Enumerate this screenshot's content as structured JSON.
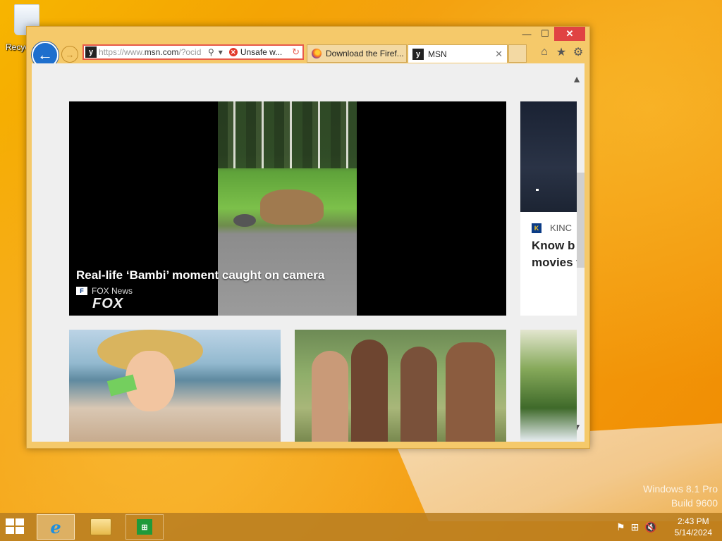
{
  "desktop": {
    "recycle_bin_label": "Recycle Bin",
    "watermark_line1": "Windows 8.1 Pro",
    "watermark_line2": "Build 9600"
  },
  "window": {
    "minimize": "—",
    "maximize": "☐",
    "close": "✕"
  },
  "navbar": {
    "back_symbol": "←",
    "forward_symbol": "→",
    "url_prefix": "https://www.",
    "url_host": "msn.com",
    "url_rest": "/?ocid",
    "search_symbol": "⚲",
    "dropdown_symbol": "▾",
    "unsafe_label": "Unsafe w...",
    "refresh_symbol": "↻"
  },
  "tabs": [
    {
      "label": "Download the Firef...",
      "icon": "firefox-icon"
    },
    {
      "label": "MSN",
      "icon": "msn-icon",
      "close": "✕"
    }
  ],
  "toolbar_icons": [
    "home-icon",
    "favorites-star-icon",
    "settings-gear-icon"
  ],
  "toolbar_symbols": {
    "home": "⌂",
    "star": "★",
    "gear": "⚙"
  },
  "hero": {
    "title": "Real-life ‘Bambi’ moment caught on camera",
    "source": "FOX News",
    "logo_text": "FOX"
  },
  "side_card": {
    "source": "KINC",
    "title": "Know b movies theater"
  },
  "scroll": {
    "up": "▲",
    "down": "▼"
  },
  "taskbar": {
    "time": "2:43 PM",
    "date": "5/14/2024",
    "tray_symbols": [
      "⚑",
      "⊞",
      "🔇"
    ]
  }
}
